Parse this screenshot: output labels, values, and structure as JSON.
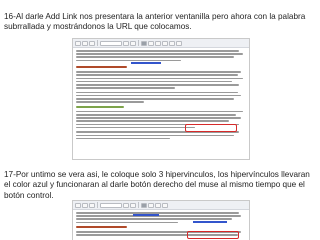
{
  "captions": {
    "step16": "16-Al darle Add Link nos presentara la anterior ventanilla pero ahora con la palabra subrrallada y mostrándonos la URL que colocamos.",
    "step17": "17-Por untimo se vera asi, le coloque solo 3 hipervinculos, los hipervínculos llevaran el color azul y funcionaran al darle botón derecho del muse al mismo tiempo que el botón control."
  },
  "colors": {
    "caption_text": "#1f1f1f",
    "highlight_box": "#d62a2a",
    "hyperlink": "#3355cc",
    "heading_orange": "#b04a2a",
    "heading_green": "#7da34a"
  }
}
